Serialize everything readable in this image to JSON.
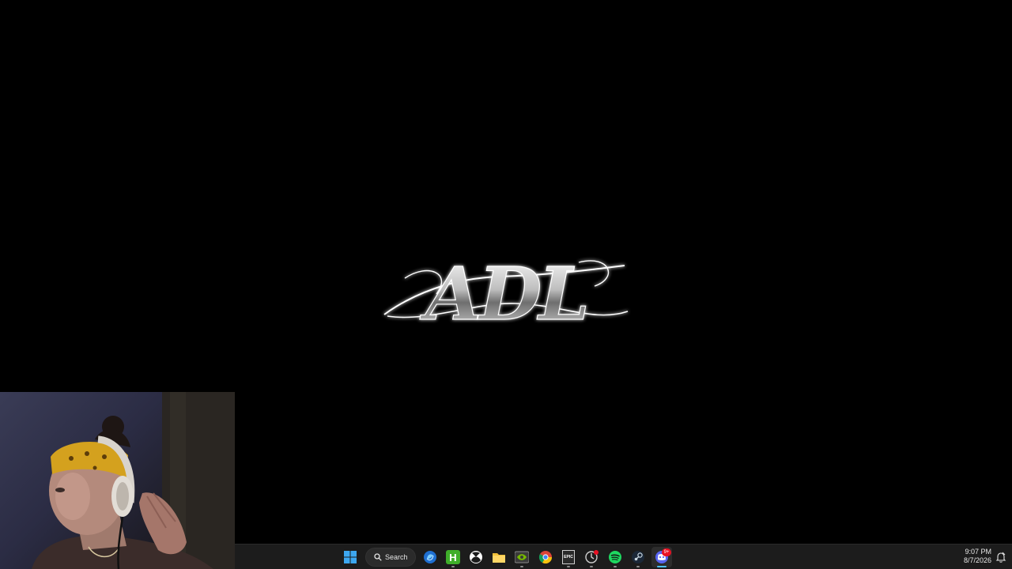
{
  "desktop": {
    "background_color": "#000000",
    "logo_text": "ADL"
  },
  "webcam": {
    "icon": "webcam-overlay"
  },
  "taskbar": {
    "background_color": "#1c1c1c",
    "search": {
      "label": "Search"
    },
    "apps": [
      {
        "name": "start",
        "icon": "windows-logo-icon"
      },
      {
        "name": "copilot",
        "icon": "copilot-icon"
      },
      {
        "name": "h-app",
        "icon": "h-app-icon",
        "text": "H"
      },
      {
        "name": "xbox",
        "icon": "xbox-icon"
      },
      {
        "name": "file-explorer",
        "icon": "folder-icon"
      },
      {
        "name": "nvidia",
        "icon": "nvidia-icon"
      },
      {
        "name": "chrome",
        "icon": "chrome-icon"
      },
      {
        "name": "epic-games",
        "icon": "epic-games-icon",
        "text": "EPIC"
      },
      {
        "name": "update-app",
        "icon": "update-icon"
      },
      {
        "name": "spotify",
        "icon": "spotify-icon"
      },
      {
        "name": "steam",
        "icon": "steam-icon"
      },
      {
        "name": "discord",
        "icon": "discord-icon",
        "badge": "9+"
      }
    ],
    "clock": {
      "time": "9:07 PM",
      "date": "8/7/2026"
    }
  }
}
